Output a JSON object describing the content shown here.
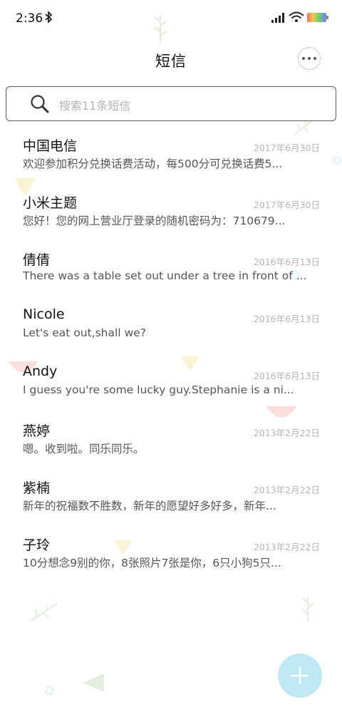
{
  "status_bar": {
    "time": "2:36"
  },
  "header": {
    "title": "短信"
  },
  "search": {
    "placeholder": "搜索11条短信"
  },
  "messages": [
    {
      "name": "中国电信",
      "date": "2017年6月30日",
      "preview": "欢迎参加积分兑换话费活动，每500分可兑换话费5..."
    },
    {
      "name": "小米主题",
      "date": "2017年6月30日",
      "preview": "您好！您的网上营业厅登录的随机密码为：710679..."
    },
    {
      "name": "倩倩",
      "date": "2016年6月13日",
      "preview": "There was a table set out under a tree in front of ..."
    },
    {
      "name": "Nicole",
      "date": "2016年6月13日",
      "preview": "Let's eat out,shall we?"
    },
    {
      "name": "Andy",
      "date": "2016年6月13日",
      "preview": "I guess you're some lucky guy.Stephanie is a ni..."
    },
    {
      "name": "燕婷",
      "date": "2013年2月22日",
      "preview": "嗯。收到啦。同乐同乐。"
    },
    {
      "name": "紫楠",
      "date": "2013年2月22日",
      "preview": "新年的祝福数不胜数，新年的愿望好多好多，新年..."
    },
    {
      "name": "子玲",
      "date": "2013年2月22日",
      "preview": "10分想念9别的你，8张照片7张是你，6只小狗5只..."
    }
  ],
  "colors": {
    "fab": "#bfe9f2",
    "accent": "#7fd3e6"
  }
}
